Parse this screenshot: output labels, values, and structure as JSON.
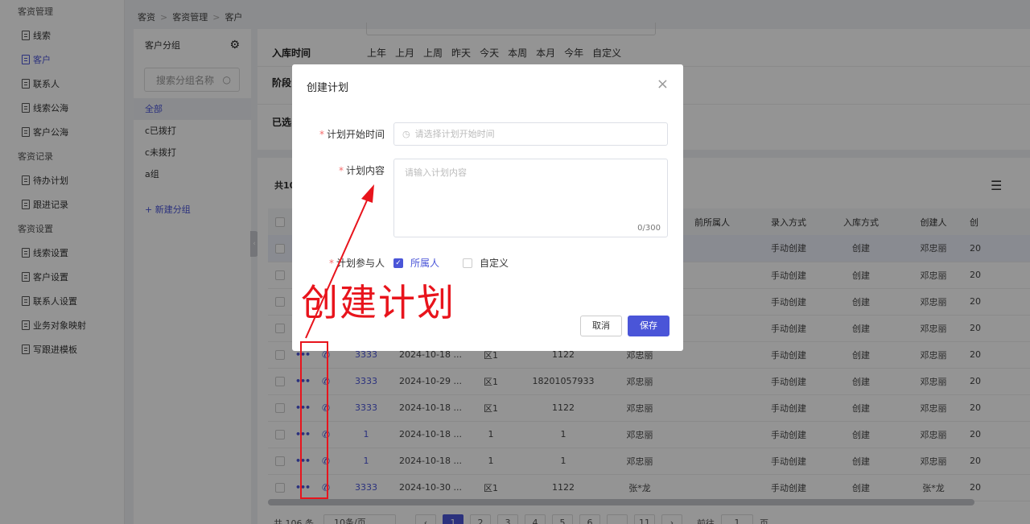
{
  "sidebar": {
    "group1": "客资管理",
    "items1": [
      "线索",
      "客户",
      "联系人",
      "线索公海",
      "客户公海"
    ],
    "group2": "客资记录",
    "items2": [
      "待办计划",
      "跟进记录"
    ],
    "group3": "客资设置",
    "items3": [
      "线索设置",
      "客户设置",
      "联系人设置",
      "业务对象映射",
      "写跟进模板"
    ]
  },
  "breadcrumb": [
    "客资",
    "客资管理",
    "客户"
  ],
  "groups": {
    "title": "客户分组",
    "search_placeholder": "搜索分组名称",
    "items": [
      "全部",
      "c已拨打",
      "c未拨打",
      "a组"
    ],
    "add_label": "+ 新建分组"
  },
  "filters": {
    "time_label": "入库时间",
    "time_options": [
      "上年",
      "上月",
      "上周",
      "昨天",
      "今天",
      "本周",
      "本月",
      "今年",
      "自定义"
    ],
    "stage_label": "阶段",
    "selected_label": "已选"
  },
  "table": {
    "total": "共10",
    "headers": [
      "",
      "",
      "",
      "",
      "",
      "",
      "",
      "",
      "前所属人",
      "录入方式",
      "入库方式",
      "创建人",
      "创"
    ],
    "rows": [
      {
        "name": "",
        "date": "",
        "area": "",
        "phone": "",
        "owner": "",
        "entry": "手动创建",
        "store": "创建",
        "creator": "邓忠丽",
        "tail": "20"
      },
      {
        "name": "",
        "date": "",
        "area": "",
        "phone": "",
        "owner": "",
        "entry": "手动创建",
        "store": "创建",
        "creator": "邓忠丽",
        "tail": "20"
      },
      {
        "name": "",
        "date": "",
        "area": "",
        "phone": "",
        "owner": "",
        "entry": "手动创建",
        "store": "创建",
        "creator": "邓忠丽",
        "tail": "20"
      },
      {
        "name": "",
        "date": "",
        "area": "",
        "phone": "",
        "owner": "",
        "entry": "手动创建",
        "store": "创建",
        "creator": "邓忠丽",
        "tail": "20"
      },
      {
        "name": "3333",
        "date": "2024-10-18 ...",
        "area": "区1",
        "phone": "1122",
        "owner": "邓忠丽",
        "entry": "手动创建",
        "store": "创建",
        "creator": "邓忠丽",
        "tail": "20"
      },
      {
        "name": "3333",
        "date": "2024-10-29 ...",
        "area": "区1",
        "phone": "18201057933",
        "owner": "邓忠丽",
        "entry": "手动创建",
        "store": "创建",
        "creator": "邓忠丽",
        "tail": "20"
      },
      {
        "name": "3333",
        "date": "2024-10-18 ...",
        "area": "区1",
        "phone": "1122",
        "owner": "邓忠丽",
        "entry": "手动创建",
        "store": "创建",
        "creator": "邓忠丽",
        "tail": "20"
      },
      {
        "name": "1",
        "date": "2024-10-18 ...",
        "area": "1",
        "phone": "1",
        "owner": "邓忠丽",
        "entry": "手动创建",
        "store": "创建",
        "creator": "邓忠丽",
        "tail": "20"
      },
      {
        "name": "1",
        "date": "2024-10-18 ...",
        "area": "1",
        "phone": "1",
        "owner": "邓忠丽",
        "entry": "手动创建",
        "store": "创建",
        "creator": "邓忠丽",
        "tail": "20"
      },
      {
        "name": "3333",
        "date": "2024-10-30 ...",
        "area": "区1",
        "phone": "1122",
        "owner": "张*龙",
        "entry": "手动创建",
        "store": "创建",
        "creator": "张*龙",
        "tail": "20"
      }
    ]
  },
  "pager": {
    "total": "共 106 条",
    "size": "10条/页",
    "pages": [
      "1",
      "2",
      "3",
      "4",
      "5",
      "6",
      "...",
      "11"
    ],
    "goto": "前往",
    "goto_value": "1",
    "goto_suffix": "页"
  },
  "modal": {
    "title": "创建计划",
    "start_label": "计划开始时间",
    "start_placeholder": "请选择计划开始时间",
    "content_label": "计划内容",
    "content_placeholder": "请输入计划内容",
    "count": "0/300",
    "participants_label": "计划参与人",
    "opt_owner": "所属人",
    "opt_custom": "自定义",
    "cancel": "取消",
    "save": "保存"
  },
  "annotation": {
    "text": "创建计划",
    "color": "#e8141c"
  },
  "colors": {
    "accent": "#4a55d8",
    "annotation": "#e8141c"
  }
}
